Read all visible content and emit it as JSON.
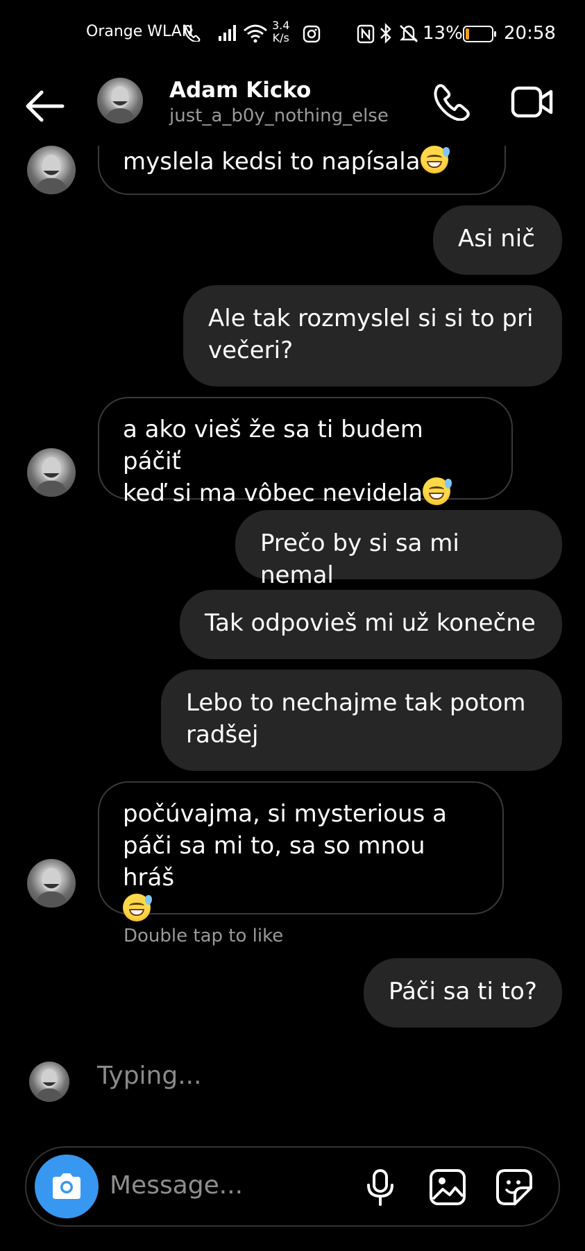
{
  "status_bar": {
    "carrier": "Orange WLAN",
    "speed_value": "3.4",
    "speed_unit": "K/s",
    "battery": "13%",
    "time": "20:58"
  },
  "header": {
    "name": "Adam Kicko",
    "username": "just_a_b0y_nothing_else"
  },
  "messages": [
    {
      "from": "them",
      "text": "myslela kedsi to napísala",
      "emoji": "sweat-smile"
    },
    {
      "from": "me",
      "text": "Asi nič"
    },
    {
      "from": "me",
      "lines": [
        "Ale tak rozmyslel si si to pri",
        "večeri?"
      ]
    },
    {
      "from": "them",
      "lines": [
        "a ako vieš že sa ti budem páčiť",
        "keď si ma vôbec nevidela"
      ],
      "emoji": "sweat-smile"
    },
    {
      "from": "me",
      "text": "Prečo by si sa mi nemal"
    },
    {
      "from": "me",
      "text": "Tak odpovieš mi už konečne"
    },
    {
      "from": "me",
      "lines": [
        "Lebo to nechajme tak potom",
        "radšej"
      ]
    },
    {
      "from": "them",
      "lines": [
        "počúvajma, si mysterious a",
        "páči sa mi to, sa so mnou hráš"
      ],
      "emoji": "sweat-smile"
    },
    {
      "from": "me",
      "text": "Páči sa ti to?"
    }
  ],
  "hint": "Double tap to like",
  "typing": "Typing...",
  "composer": {
    "placeholder": "Message..."
  },
  "colors": {
    "background": "#000000",
    "outgoing_bubble": "#262626",
    "camera_button": "#3897f0"
  }
}
